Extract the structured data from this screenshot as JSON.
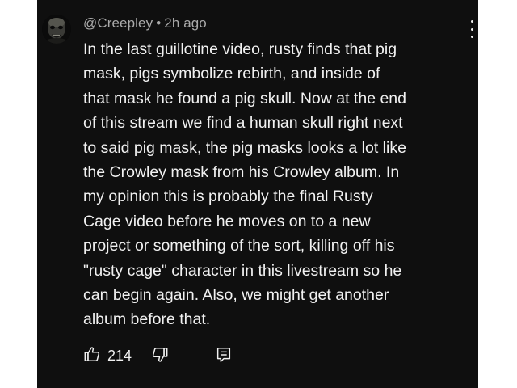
{
  "comment": {
    "author": "@Creepley",
    "separator": "•",
    "time": "2h ago",
    "lines": [
      "In the last guillotine video, rusty finds that pig",
      "mask, pigs symbolize rebirth, and inside of",
      "that mask he found a pig skull. Now at the end",
      "of this stream we find a human skull right next",
      "to said pig mask, the pig masks looks a lot like",
      "the Crowley mask from his Crowley album. In",
      "my opinion this is probably the final Rusty",
      "Cage video before he moves on to a new",
      "project or something of the sort, killing off his",
      "\"rusty cage\" character in this livestream so he",
      "can begin again. Also, we might get another",
      "album before that."
    ],
    "likes": "214"
  },
  "icons": {
    "avatar": "dark-face-avatar",
    "more": "vertical-ellipsis-icon",
    "like": "thumbs-up-icon",
    "dislike": "thumbs-down-icon",
    "reply": "reply-comment-icon"
  },
  "colors": {
    "background": "#0f0f0f",
    "text": "#f1f1f1",
    "meta": "#aaaaaa",
    "page": "#ffffff"
  }
}
